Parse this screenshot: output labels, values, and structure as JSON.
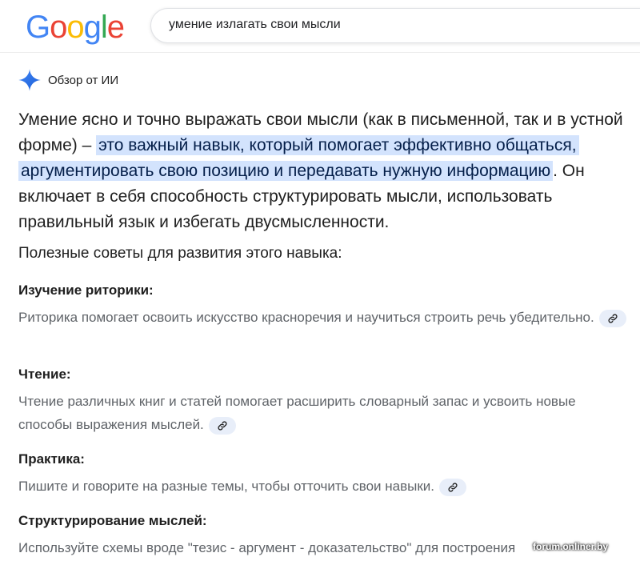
{
  "logo": {
    "letters": [
      "G",
      "o",
      "o",
      "g",
      "l",
      "e"
    ],
    "colors": [
      "#4285F4",
      "#EA4335",
      "#FBBC05",
      "#4285F4",
      "#34A853",
      "#EA4335"
    ]
  },
  "search": {
    "query": "умение излагать свои мысли"
  },
  "ai_overview": {
    "title": "Обзор от ИИ",
    "icon": "sparkle-icon",
    "accent": "#1a73e8",
    "summary_before": "Умение ясно и точно выражать свои мысли (как в письменной, так и в устной форме) – ",
    "summary_highlight": "это важный навык, который помогает эффективно общаться, аргументировать свою позицию и передавать нужную информацию",
    "summary_after": ". Он включает в себя способность структурировать мысли, использовать правильный язык и избегать двусмысленности."
  },
  "tips": {
    "heading": "Полезные советы для развития этого навыка:",
    "items": [
      {
        "title": "Изучение риторики:",
        "text": "Риторика помогает освоить искусство красноречия и научиться строить речь убедительно."
      },
      {
        "title": "Чтение:",
        "text": "Чтение различных книг и статей помогает расширить словарный запас и усвоить новые способы выражения мыслей."
      },
      {
        "title": "Практика:",
        "text": "Пишите и говорите на разные темы, чтобы отточить свои навыки."
      },
      {
        "title": "Структурирование мыслей:",
        "text": "Используйте схемы вроде \"тезис - аргумент - доказательство\" для построения"
      }
    ]
  },
  "watermark": "forum.onliner.by"
}
